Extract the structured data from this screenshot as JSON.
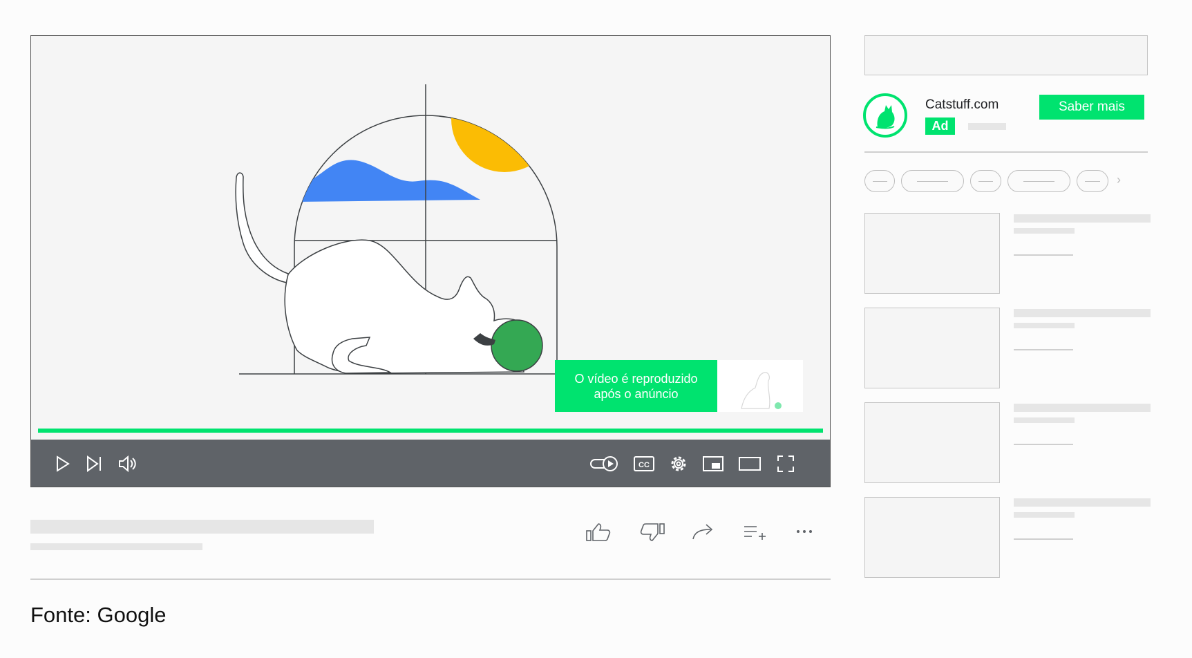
{
  "player": {
    "overlay_text_line1": "O vídeo é reproduzido",
    "overlay_text_line2": "após o anúncio",
    "progress": 1.0,
    "controls": [
      "play-icon",
      "next-icon",
      "volume-icon",
      "autoplay-toggle-icon",
      "captions-icon",
      "settings-gear-icon",
      "miniplayer-icon",
      "theater-mode-icon",
      "fullscreen-icon"
    ],
    "captions_label": "CC"
  },
  "actions": [
    "like-icon",
    "dislike-icon",
    "share-icon",
    "save-to-playlist-icon",
    "more-icon"
  ],
  "ad": {
    "brand": "Catstuff.com",
    "badge": "Ad",
    "cta": "Saber mais"
  },
  "source": "Fonte: Google",
  "colors": {
    "accent_green": "#00e36f",
    "controls_bg": "#5f6368",
    "sun_yellow": "#fbbc04",
    "hill_blue": "#4285f4",
    "ball_green": "#34a853"
  }
}
